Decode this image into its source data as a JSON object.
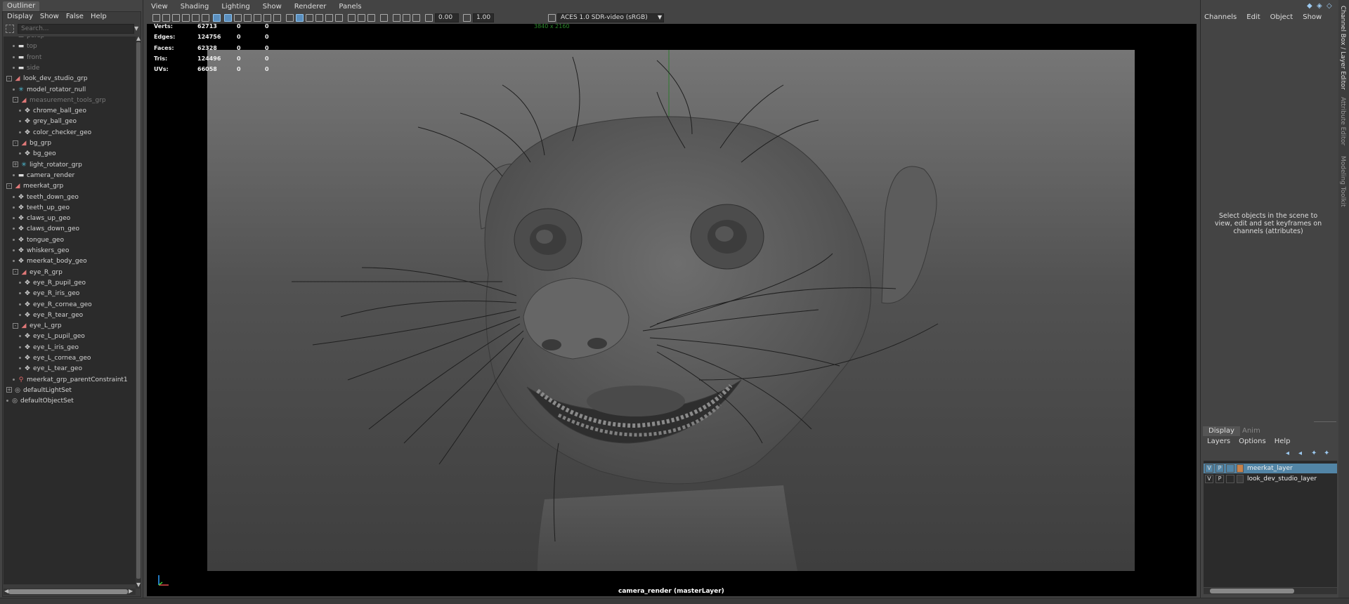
{
  "outliner": {
    "tab_label": "Outliner",
    "menu": [
      "Display",
      "Show",
      "False",
      "Help"
    ],
    "search_placeholder": "Search...",
    "items": [
      {
        "label": "persp",
        "depth": 1,
        "icon": "camera",
        "dim": true
      },
      {
        "label": "top",
        "depth": 1,
        "icon": "camera",
        "dim": true
      },
      {
        "label": "front",
        "depth": 1,
        "icon": "camera",
        "dim": true
      },
      {
        "label": "side",
        "depth": 1,
        "icon": "camera",
        "dim": true
      },
      {
        "label": "look_dev_studio_grp",
        "depth": 0,
        "icon": "group",
        "expand": "-"
      },
      {
        "label": "model_rotator_null",
        "depth": 1,
        "icon": "null"
      },
      {
        "label": "measurement_tools_grp",
        "depth": 1,
        "icon": "group",
        "expand": "-",
        "dim": true
      },
      {
        "label": "chrome_ball_geo",
        "depth": 2,
        "icon": "geo"
      },
      {
        "label": "grey_ball_geo",
        "depth": 2,
        "icon": "geo"
      },
      {
        "label": "color_checker_geo",
        "depth": 2,
        "icon": "geo"
      },
      {
        "label": "bg_grp",
        "depth": 1,
        "icon": "group",
        "expand": "-"
      },
      {
        "label": "bg_geo",
        "depth": 2,
        "icon": "geo"
      },
      {
        "label": "light_rotator_grp",
        "depth": 1,
        "icon": "null",
        "expand": "+"
      },
      {
        "label": "camera_render",
        "depth": 1,
        "icon": "camera"
      },
      {
        "label": "meerkat_grp",
        "depth": 0,
        "icon": "group",
        "expand": "-"
      },
      {
        "label": "teeth_down_geo",
        "depth": 1,
        "icon": "geo"
      },
      {
        "label": "teeth_up_geo",
        "depth": 1,
        "icon": "geo"
      },
      {
        "label": "claws_up_geo",
        "depth": 1,
        "icon": "geo"
      },
      {
        "label": "claws_down_geo",
        "depth": 1,
        "icon": "geo"
      },
      {
        "label": "tongue_geo",
        "depth": 1,
        "icon": "geo"
      },
      {
        "label": "whiskers_geo",
        "depth": 1,
        "icon": "geo"
      },
      {
        "label": "meerkat_body_geo",
        "depth": 1,
        "icon": "geo"
      },
      {
        "label": "eye_R_grp",
        "depth": 1,
        "icon": "group",
        "expand": "-"
      },
      {
        "label": "eye_R_pupil_geo",
        "depth": 2,
        "icon": "geo"
      },
      {
        "label": "eye_R_iris_geo",
        "depth": 2,
        "icon": "geo"
      },
      {
        "label": "eye_R_cornea_geo",
        "depth": 2,
        "icon": "geo"
      },
      {
        "label": "eye_R_tear_geo",
        "depth": 2,
        "icon": "geo"
      },
      {
        "label": "eye_L_grp",
        "depth": 1,
        "icon": "group",
        "expand": "-"
      },
      {
        "label": "eye_L_pupil_geo",
        "depth": 2,
        "icon": "geo"
      },
      {
        "label": "eye_L_iris_geo",
        "depth": 2,
        "icon": "geo"
      },
      {
        "label": "eye_L_cornea_geo",
        "depth": 2,
        "icon": "geo"
      },
      {
        "label": "eye_L_tear_geo",
        "depth": 2,
        "icon": "geo"
      },
      {
        "label": "meerkat_grp_parentConstraint1",
        "depth": 1,
        "icon": "constraint"
      },
      {
        "label": "defaultLightSet",
        "depth": 0,
        "icon": "set",
        "expand": "+"
      },
      {
        "label": "defaultObjectSet",
        "depth": 0,
        "icon": "set"
      }
    ]
  },
  "viewport": {
    "menu": [
      "View",
      "Shading",
      "Lighting",
      "Show",
      "Renderer",
      "Panels"
    ],
    "exposure_value": "0.00",
    "gamma_value": "1.00",
    "color_space": "ACES 1.0 SDR-video (sRGB)",
    "resolution_gate": "3840 x 2160",
    "camera_label": "camera_render (masterLayer)",
    "hud": [
      {
        "label": "Verts:",
        "values": [
          "62713",
          "0",
          "0"
        ]
      },
      {
        "label": "Edges:",
        "values": [
          "124756",
          "0",
          "0"
        ]
      },
      {
        "label": "Faces:",
        "values": [
          "62328",
          "0",
          "0"
        ]
      },
      {
        "label": "Tris:",
        "values": [
          "124496",
          "0",
          "0"
        ]
      },
      {
        "label": "UVs:",
        "values": [
          "66058",
          "0",
          "0"
        ]
      }
    ]
  },
  "channel_box": {
    "menu": [
      "Channels",
      "Edit",
      "Object",
      "Show"
    ],
    "hint": "Select objects in the scene to view, edit and set keyframes on channels (attributes)"
  },
  "layer_editor": {
    "tabs": [
      "Display",
      "Anim"
    ],
    "menu": [
      "Layers",
      "Options",
      "Help"
    ],
    "layers": [
      {
        "v": "V",
        "p": "P",
        "name": "meerkat_layer",
        "color": "#c8824a",
        "selected": true
      },
      {
        "v": "V",
        "p": "P",
        "name": "look_dev_studio_layer",
        "color": "#3a3a3a",
        "selected": false
      }
    ]
  },
  "side_tabs": [
    "Channel Box / Layer Editor",
    "Attribute Editor",
    "Modeling Toolkit"
  ],
  "colors": {
    "accent": "#5285a6",
    "selection": "#5285a6",
    "null_icon": "#4fc1d9",
    "group_icon": "#e07878"
  }
}
